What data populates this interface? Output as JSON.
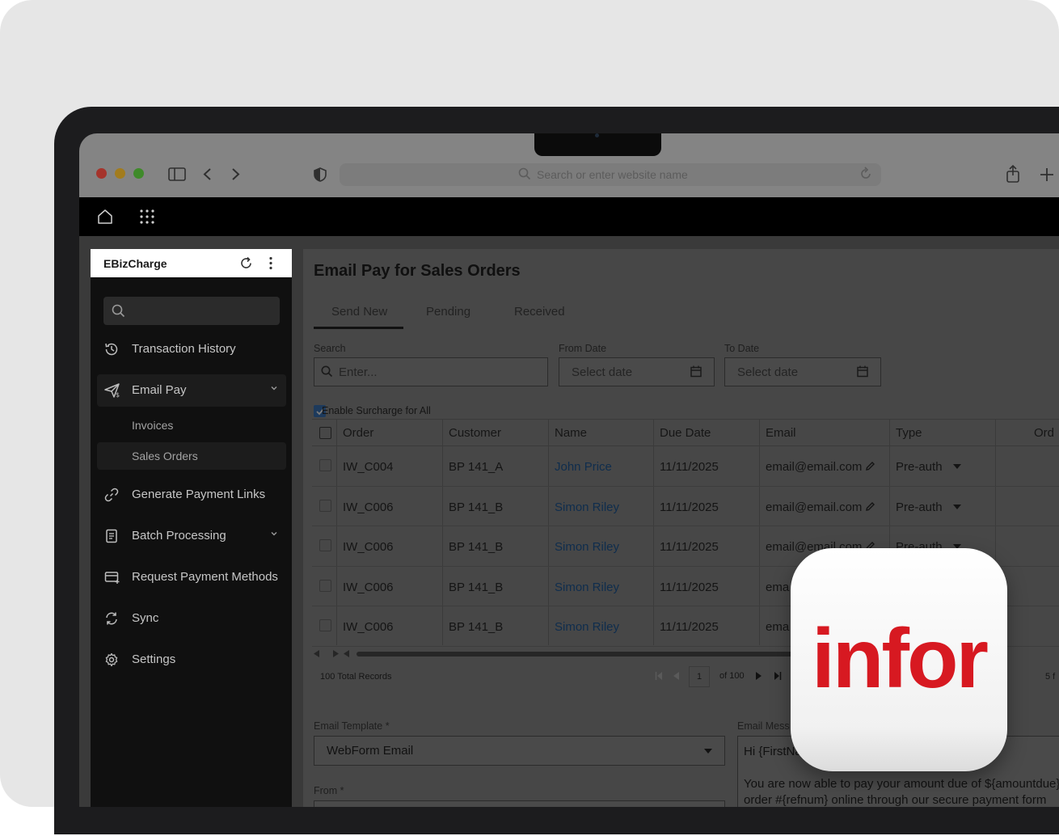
{
  "browser": {
    "url_placeholder": "Search or enter website name"
  },
  "sidebar": {
    "brand": "EBizCharge",
    "search_value": "",
    "items": [
      {
        "label": "Transaction History",
        "icon": "history-icon"
      },
      {
        "label": "Email Pay",
        "icon": "send-money-icon",
        "expanded": true
      },
      {
        "label": "Generate Payment Links",
        "icon": "link-icon"
      },
      {
        "label": "Batch Processing",
        "icon": "batch-document-icon",
        "expanded": false
      },
      {
        "label": "Request Payment Methods",
        "icon": "card-add-icon"
      },
      {
        "label": "Sync",
        "icon": "sync-icon"
      },
      {
        "label": "Settings",
        "icon": "gear-icon"
      }
    ],
    "email_pay_children": [
      {
        "label": "Invoices"
      },
      {
        "label": "Sales Orders",
        "active": true
      }
    ]
  },
  "main": {
    "title": "Email Pay for Sales Orders",
    "tabs": [
      {
        "label": "Send New",
        "active": true
      },
      {
        "label": "Pending"
      },
      {
        "label": "Received"
      }
    ],
    "filters": {
      "search_label": "Search",
      "search_placeholder": "Enter...",
      "from_label": "From Date",
      "from_placeholder": "Select date",
      "to_label": "To Date",
      "to_placeholder": "Select date"
    },
    "surcharge_label": "Enable Surcharge for All",
    "surcharge_checked": true,
    "table": {
      "columns": [
        "Order",
        "Customer",
        "Name",
        "Due Date",
        "Email",
        "Type",
        "Ord"
      ],
      "rows": [
        {
          "order": "IW_C004",
          "customer": "BP 141_A",
          "name": "John Price",
          "due": "11/11/2025",
          "email": "email@email.com",
          "type": "Pre-auth"
        },
        {
          "order": "IW_C006",
          "customer": "BP 141_B",
          "name": "Simon Riley",
          "due": "11/11/2025",
          "email": "email@email.com",
          "type": "Pre-auth"
        },
        {
          "order": "IW_C006",
          "customer": "BP 141_B",
          "name": "Simon Riley",
          "due": "11/11/2025",
          "email": "email@email.com",
          "type": "Pre-auth"
        },
        {
          "order": "IW_C006",
          "customer": "BP 141_B",
          "name": "Simon Riley",
          "due": "11/11/2025",
          "email": "ema",
          "type": ""
        },
        {
          "order": "IW_C006",
          "customer": "BP 141_B",
          "name": "Simon Riley",
          "due": "11/11/2025",
          "email": "ema",
          "type": ""
        }
      ]
    },
    "pager": {
      "total": "100 Total Records",
      "page": "1",
      "of": "of 100",
      "right": "5 f"
    },
    "email_template": {
      "label": "Email Template",
      "required": "*",
      "value": "WebForm Email"
    },
    "from": {
      "label": "From",
      "required": "*"
    },
    "email_message": {
      "label": "Email Mess",
      "line1": "Hi {FirstNa",
      "line2": "You are now able to pay your amount due of ${amountdue}",
      "line3": "order #{refnum} online through our secure payment form"
    }
  },
  "badge": {
    "logo_text": "infor",
    "color": "#d71921"
  }
}
